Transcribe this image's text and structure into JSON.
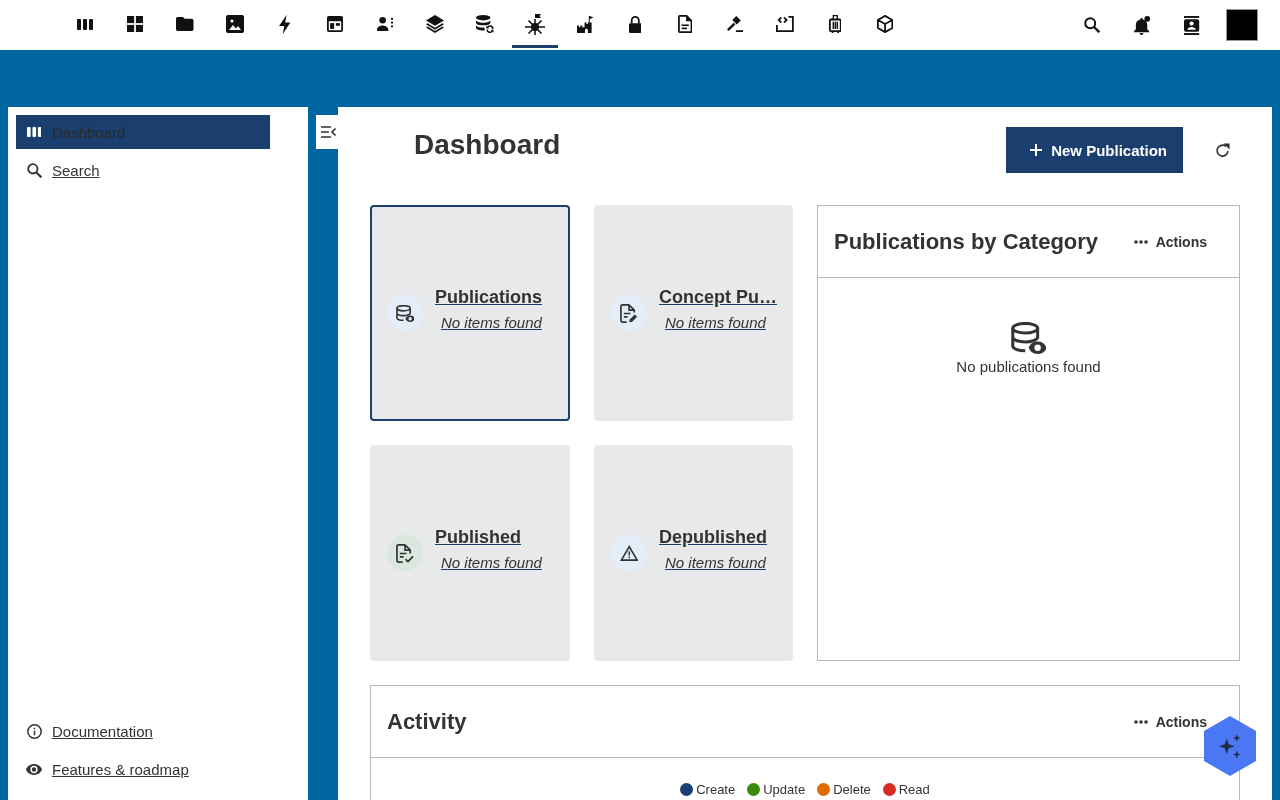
{
  "top_nav": {
    "items": [
      {
        "kind": "columns",
        "selected": false
      },
      {
        "kind": "grid",
        "selected": false
      },
      {
        "kind": "folder",
        "selected": false
      },
      {
        "kind": "image",
        "selected": false
      },
      {
        "kind": "bolt",
        "selected": false
      },
      {
        "kind": "layout",
        "selected": false
      },
      {
        "kind": "people",
        "selected": false
      },
      {
        "kind": "layers",
        "selected": false
      },
      {
        "kind": "dbsync",
        "selected": false
      },
      {
        "kind": "starburst",
        "selected": true
      },
      {
        "kind": "castle",
        "selected": false
      },
      {
        "kind": "lock",
        "selected": false
      },
      {
        "kind": "doc",
        "selected": false
      },
      {
        "kind": "gavel",
        "selected": false
      },
      {
        "kind": "code",
        "selected": false
      },
      {
        "kind": "luggage",
        "selected": false
      },
      {
        "kind": "cube",
        "selected": false
      }
    ]
  },
  "sidebar": {
    "items": [
      {
        "kind": "columns",
        "label": "Dashboard",
        "selected": true
      },
      {
        "kind": "search",
        "label": "Search",
        "selected": false
      }
    ],
    "footer_links": [
      {
        "kind": "info",
        "label": "Documentation"
      },
      {
        "kind": "eye",
        "label": "Features & roadmap"
      }
    ]
  },
  "page": {
    "title": "Dashboard",
    "primary_button": "New Publication"
  },
  "stat_cards": [
    {
      "kind": "dbeye",
      "title": "Publications",
      "subtitle": "No items found",
      "selected": true,
      "color": "#e3eef8"
    },
    {
      "kind": "docedit",
      "title": "Concept Pu…",
      "subtitle": "No items found",
      "selected": false,
      "color": "#e3eef8"
    },
    {
      "kind": "doccheck",
      "title": "Published",
      "subtitle": "No items found",
      "selected": false,
      "color": "#d9e7de"
    },
    {
      "kind": "warning",
      "title": "Depublished",
      "subtitle": "No items found",
      "selected": false,
      "color": "#e3eef8"
    }
  ],
  "category_panel": {
    "title": "Publications by Category",
    "actions_label": "Actions",
    "empty_text": "No publications found"
  },
  "activity": {
    "title": "Activity",
    "actions_label": "Actions",
    "legend": [
      {
        "label": "Create",
        "color": "#1c3f72"
      },
      {
        "label": "Update",
        "color": "#3a8a0e"
      },
      {
        "label": "Delete",
        "color": "#e06b00"
      },
      {
        "label": "Read",
        "color": "#d82c20"
      }
    ]
  }
}
